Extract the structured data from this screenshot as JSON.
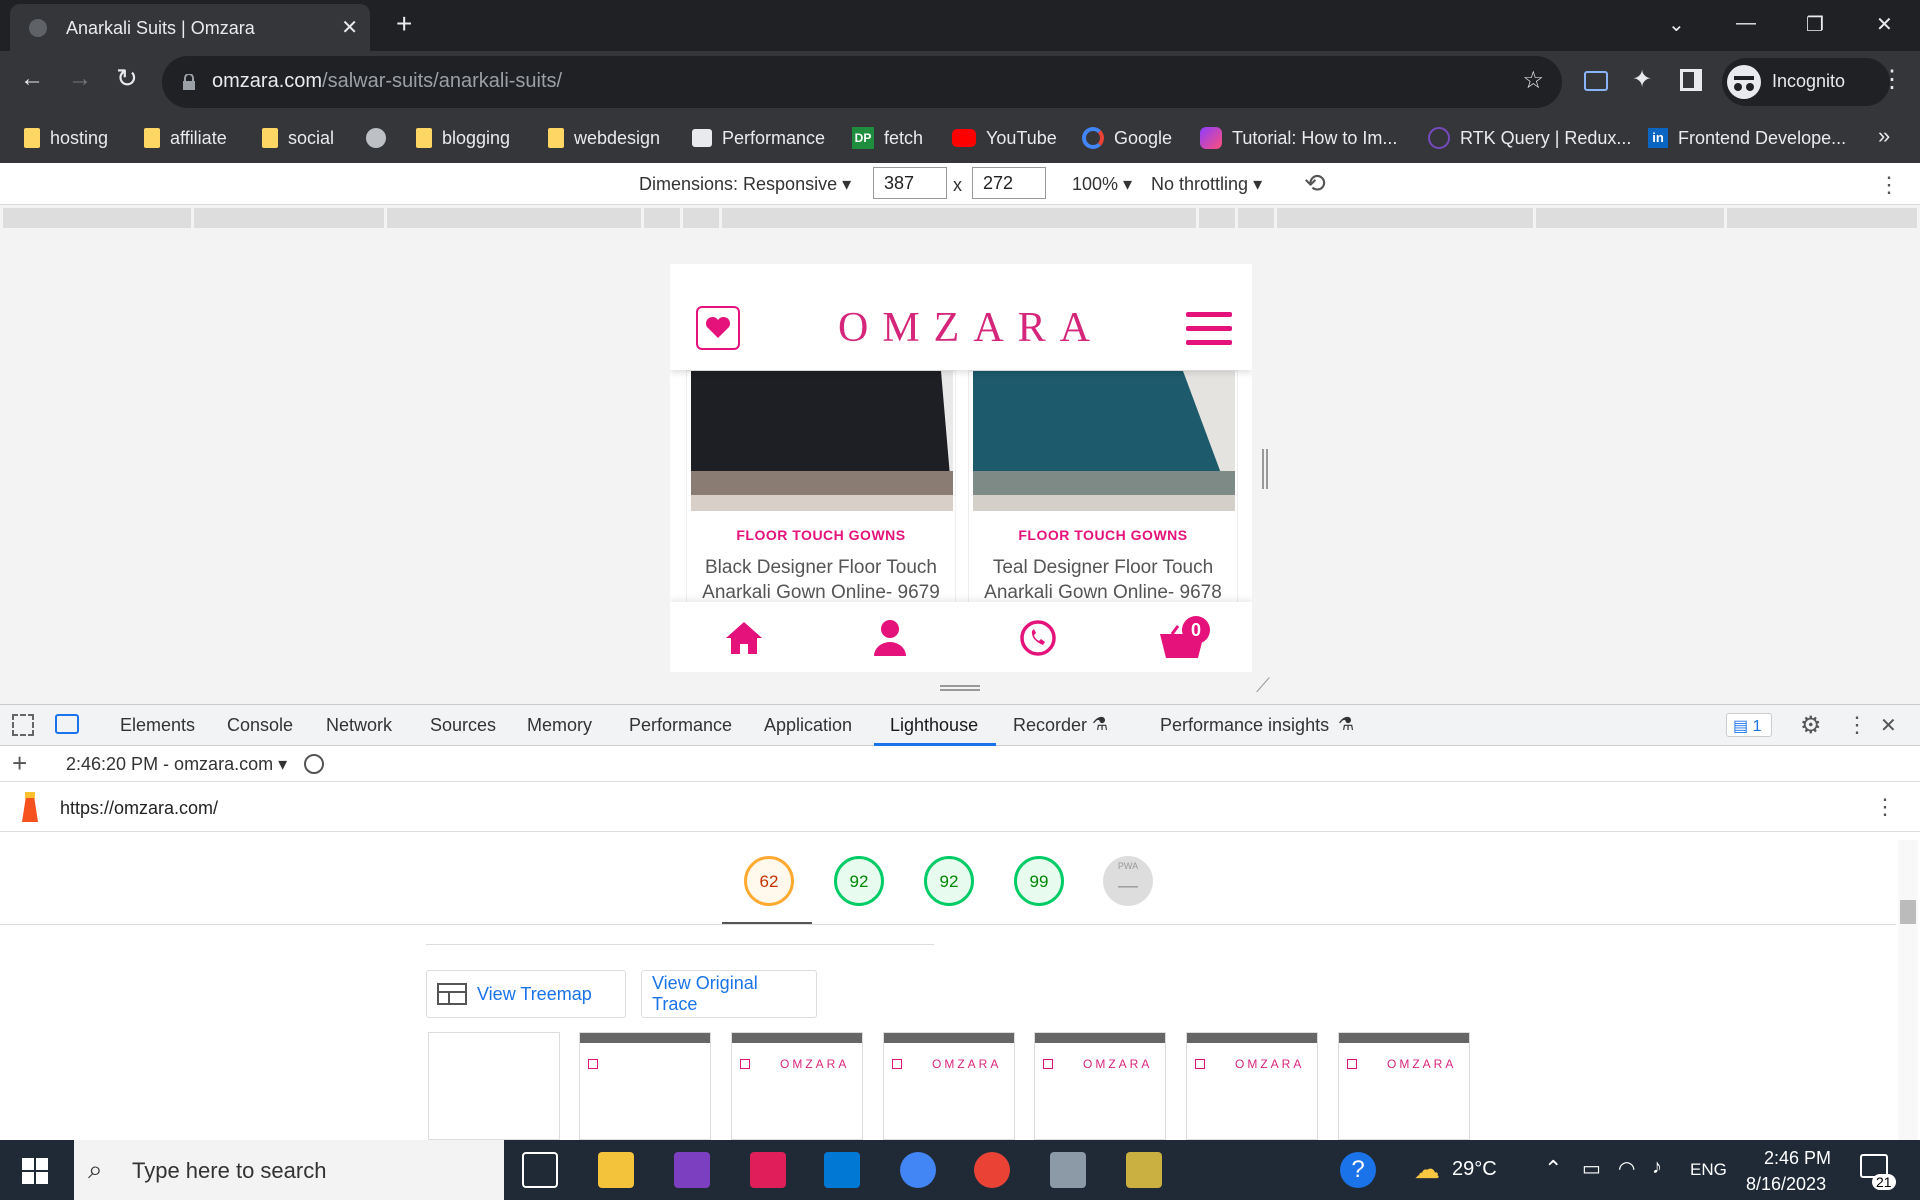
{
  "browser": {
    "tab_title": "Anarkali Suits | Omzara",
    "url_domain": "omzara.com",
    "url_path": "/salwar-suits/anarkali-suits/",
    "profile_label": "Incognito",
    "bookmarks": [
      "hosting",
      "affiliate",
      "social",
      "blogging",
      "webdesign",
      "Performance",
      "fetch",
      "YouTube",
      "Google",
      "Tutorial: How to Im...",
      "RTK Query | Redux...",
      "Frontend Develope..."
    ]
  },
  "device_toolbar": {
    "dimensions_label": "Dimensions: Responsive",
    "width": "387",
    "height": "272",
    "times": "x",
    "zoom": "100%",
    "throttling": "No throttling"
  },
  "site": {
    "logo_text": "OMZARA",
    "cart_count": "0",
    "products": [
      {
        "category": "FLOOR TOUCH GOWNS",
        "name": "Black Designer Floor Touch Anarkali Gown Online- 9679"
      },
      {
        "category": "FLOOR TOUCH GOWNS",
        "name": "Teal Designer Floor Touch Anarkali Gown Online- 9678"
      }
    ]
  },
  "devtools": {
    "tabs": [
      "Elements",
      "Console",
      "Network",
      "Sources",
      "Memory",
      "Performance",
      "Application",
      "Lighthouse",
      "Recorder",
      "Performance insights"
    ],
    "active_tab": "Lighthouse",
    "issues_count": "1",
    "report_selector": "2:46:20 PM - omzara.com",
    "report_url": "https://omzara.com/",
    "scores": [
      "62",
      "92",
      "92",
      "99"
    ],
    "pwa_label": "PWA",
    "view_treemap": "View Treemap",
    "view_trace": "View Original Trace"
  },
  "taskbar": {
    "search_placeholder": "Type here to search",
    "temperature": "29°C",
    "language": "ENG",
    "time": "2:46 PM",
    "date": "8/16/2023",
    "notifications": "21"
  },
  "colors": {
    "brand": "#e4127a",
    "score_orange": "#fa3",
    "score_green": "#0c6"
  }
}
